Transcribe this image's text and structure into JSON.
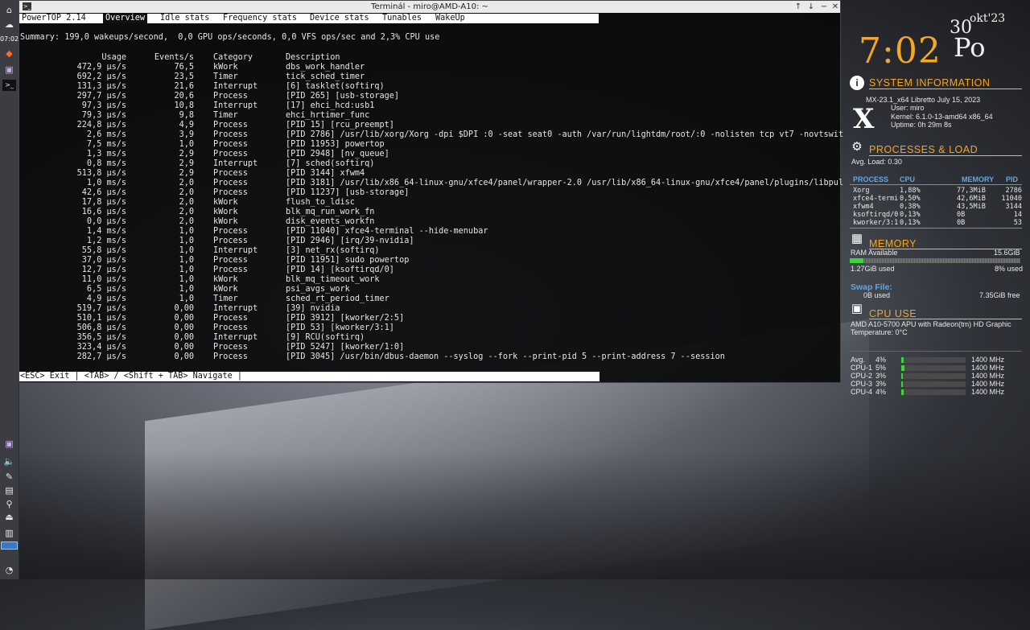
{
  "terminal": {
    "title": "Terminál - miro@AMD-A10: ~",
    "controls": {
      "up": "↑",
      "down": "↓",
      "min": "−",
      "close": "✕"
    }
  },
  "powertop": {
    "tabs": [
      "PowerTOP 2.14",
      "Overview",
      "Idle stats",
      "Frequency stats",
      "Device stats",
      "Tunables",
      "WakeUp"
    ],
    "summary": "Summary: 199,0 wakeups/second,  0,0 GPU ops/seconds, 0,0 VFS ops/sec and 2,3% CPU use",
    "headers": {
      "usage": "Usage",
      "events": "Events/s",
      "category": "Category",
      "description": "Description"
    },
    "rows": [
      {
        "usage": "472,9 µs/s",
        "events": "76,5",
        "category": "kWork",
        "description": "dbs_work_handler"
      },
      {
        "usage": "692,2 µs/s",
        "events": "23,5",
        "category": "Timer",
        "description": "tick_sched_timer"
      },
      {
        "usage": "131,3 µs/s",
        "events": "21,6",
        "category": "Interrupt",
        "description": "[6] tasklet(softirq)"
      },
      {
        "usage": "297,7 µs/s",
        "events": "20,6",
        "category": "Process",
        "description": "[PID 265] [usb-storage]"
      },
      {
        "usage": "97,3 µs/s",
        "events": "10,8",
        "category": "Interrupt",
        "description": "[17] ehci_hcd:usb1"
      },
      {
        "usage": "79,3 µs/s",
        "events": "9,8",
        "category": "Timer",
        "description": "ehci_hrtimer_func"
      },
      {
        "usage": "224,8 µs/s",
        "events": "4,9",
        "category": "Process",
        "description": "[PID 15] [rcu_preempt]"
      },
      {
        "usage": "2,6 ms/s",
        "events": "3,9",
        "category": "Process",
        "description": "[PID 2786] /usr/lib/xorg/Xorg -dpi $DPI :0 -seat seat0 -auth /var/run/lightdm/root/:0 -nolisten tcp vt7 -novtswit"
      },
      {
        "usage": "7,5 ms/s",
        "events": "1,0",
        "category": "Process",
        "description": "[PID 11953] powertop"
      },
      {
        "usage": "1,3 ms/s",
        "events": "2,9",
        "category": "Process",
        "description": "[PID 2948] [nv_queue]"
      },
      {
        "usage": "0,8 ms/s",
        "events": "2,9",
        "category": "Interrupt",
        "description": "[7] sched(softirq)"
      },
      {
        "usage": "513,8 µs/s",
        "events": "2,9",
        "category": "Process",
        "description": "[PID 3144] xfwm4"
      },
      {
        "usage": "1,0 ms/s",
        "events": "2,0",
        "category": "Process",
        "description": "[PID 3181] /usr/lib/x86_64-linux-gnu/xfce4/panel/wrapper-2.0 /usr/lib/x86_64-linux-gnu/xfce4/panel/plugins/libpul"
      },
      {
        "usage": "42,6 µs/s",
        "events": "2,0",
        "category": "Process",
        "description": "[PID 11237] [usb-storage]"
      },
      {
        "usage": "17,8 µs/s",
        "events": "2,0",
        "category": "kWork",
        "description": "flush_to_ldisc"
      },
      {
        "usage": "16,6 µs/s",
        "events": "2,0",
        "category": "kWork",
        "description": "blk_mq_run_work_fn"
      },
      {
        "usage": "0,0 µs/s",
        "events": "2,0",
        "category": "kWork",
        "description": "disk_events_workfn"
      },
      {
        "usage": "1,4 ms/s",
        "events": "1,0",
        "category": "Process",
        "description": "[PID 11040] xfce4-terminal --hide-menubar"
      },
      {
        "usage": "1,2 ms/s",
        "events": "1,0",
        "category": "Process",
        "description": "[PID 2946] [irq/39-nvidia]"
      },
      {
        "usage": "55,8 µs/s",
        "events": "1,0",
        "category": "Interrupt",
        "description": "[3] net_rx(softirq)"
      },
      {
        "usage": "37,0 µs/s",
        "events": "1,0",
        "category": "Process",
        "description": "[PID 11951] sudo powertop"
      },
      {
        "usage": "12,7 µs/s",
        "events": "1,0",
        "category": "Process",
        "description": "[PID 14] [ksoftirqd/0]"
      },
      {
        "usage": "11,0 µs/s",
        "events": "1,0",
        "category": "kWork",
        "description": "blk_mq_timeout_work"
      },
      {
        "usage": "6,5 µs/s",
        "events": "1,0",
        "category": "kWork",
        "description": "psi_avgs_work"
      },
      {
        "usage": "4,9 µs/s",
        "events": "1,0",
        "category": "Timer",
        "description": "sched_rt_period_timer"
      },
      {
        "usage": "519,7 µs/s",
        "events": "0,00",
        "category": "Interrupt",
        "description": "[39] nvidia"
      },
      {
        "usage": "510,1 µs/s",
        "events": "0,00",
        "category": "Process",
        "description": "[PID 3912] [kworker/2:5]"
      },
      {
        "usage": "506,8 µs/s",
        "events": "0,00",
        "category": "Process",
        "description": "[PID 53] [kworker/3:1]"
      },
      {
        "usage": "356,5 µs/s",
        "events": "0,00",
        "category": "Interrupt",
        "description": "[9] RCU(softirq)"
      },
      {
        "usage": "323,4 µs/s",
        "events": "0,00",
        "category": "Process",
        "description": "[PID 5247] [kworker/1:0]"
      },
      {
        "usage": "282,7 µs/s",
        "events": "0,00",
        "category": "Process",
        "description": "[PID 3045] /usr/bin/dbus-daemon --syslog --fork --print-pid 5 --print-address 7 --session"
      }
    ],
    "footer": "<ESC> Exit | <TAB> / <Shift + TAB> Navigate |"
  },
  "left_panel": {
    "clock": "07:02"
  },
  "conky": {
    "time": "7:02",
    "day": "30",
    "month": "okt'23",
    "weekday": "Po",
    "system": {
      "title": "SYSTEM INFORMATION",
      "distro": "MX-23.1_x64 Libretto July 15, 2023",
      "user": "User: miro",
      "kernel": "Kernel: 6.1.0-13-amd64 x86_64",
      "uptime": "Uptime: 0h 29m 8s"
    },
    "processes": {
      "title": "PROCESSES & LOAD",
      "avg_load": "Avg. Load: 0.30",
      "headers": {
        "process": "PROCESS",
        "cpu": "CPU",
        "memory": "MEMORY",
        "pid": "PID"
      },
      "rows": [
        {
          "name": "Xorg",
          "cpu": "1,88%",
          "mem": "77,3MiB",
          "pid": "2786"
        },
        {
          "name": "xfce4-termi",
          "cpu": "0,50%",
          "mem": "42,6MiB",
          "pid": "11040"
        },
        {
          "name": "xfwm4",
          "cpu": "0,38%",
          "mem": "43,5MiB",
          "pid": "3144"
        },
        {
          "name": "ksoftirqd/0",
          "cpu": "0,13%",
          "mem": "0B",
          "pid": "14"
        },
        {
          "name": "kworker/3:1",
          "cpu": "0,13%",
          "mem": "0B",
          "pid": "53"
        }
      ]
    },
    "memory": {
      "title": "MEMORY",
      "ram_label": "RAM Available",
      "ram_total": "15.6GiB",
      "used": "1.27GiB used",
      "used_pct": "8% used",
      "used_fraction": 0.08,
      "swap_title": "Swap File:",
      "swap_used": "0B used",
      "swap_free": "7.35GiB free"
    },
    "cpu": {
      "title": "CPU USE",
      "model": "AMD A10-5700 APU with Radeon(tm) HD Graphic",
      "temp": "Temperature:  0°C",
      "cores": [
        {
          "name": "Avg.",
          "pct": "4%",
          "value": 0.04,
          "freq": "1400 MHz"
        },
        {
          "name": "CPU-1",
          "pct": "5%",
          "value": 0.05,
          "freq": "1400 MHz"
        },
        {
          "name": "CPU-2",
          "pct": "3%",
          "value": 0.03,
          "freq": "1400 MHz"
        },
        {
          "name": "CPU-3",
          "pct": "3%",
          "value": 0.03,
          "freq": "1400 MHz"
        },
        {
          "name": "CPU-4",
          "pct": "4%",
          "value": 0.04,
          "freq": "1400 MHz"
        }
      ]
    }
  }
}
